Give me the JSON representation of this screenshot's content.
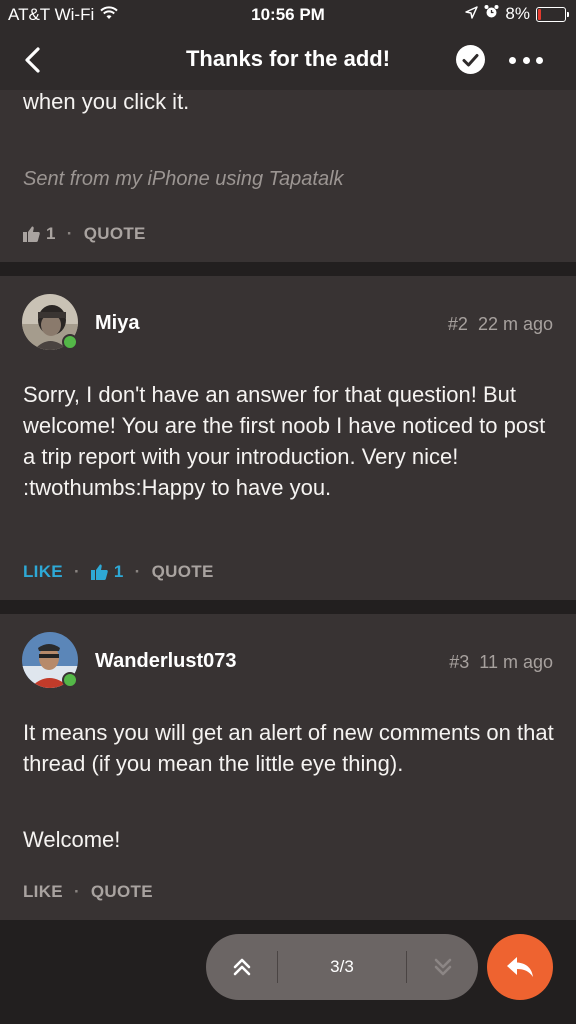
{
  "status": {
    "carrier": "AT&T Wi-Fi",
    "time": "10:56 PM",
    "battery": "8%",
    "battery_level": 0.08
  },
  "nav": {
    "title": "Thanks for the add!"
  },
  "posts": [
    {
      "text": "when you click it.",
      "signature": "Sent from my iPhone using Tapatalk",
      "like_count": "1",
      "quote": "QUOTE"
    },
    {
      "username": "Miya",
      "post_number": "#2",
      "time_ago": "22 m ago",
      "text": "Sorry, I don't have an answer for that question! But welcome! You are the first noob I have noticed to post a trip report with your introduction. Very nice! :twothumbs:Happy to have you.",
      "like": "LIKE",
      "like_count": "1",
      "quote": "QUOTE"
    },
    {
      "username": "Wanderlust073",
      "post_number": "#3",
      "time_ago": "11 m ago",
      "text_line1": "It means you will get an alert of new comments on that thread (if you mean the little eye thing).",
      "text_line2": "Welcome!",
      "like": "LIKE",
      "quote": "QUOTE"
    }
  ],
  "pager": {
    "page": "3/3"
  },
  "colors": {
    "accent_blue": "#2ea9d6",
    "fab_orange": "#ee6330",
    "online_green": "#54b848"
  }
}
